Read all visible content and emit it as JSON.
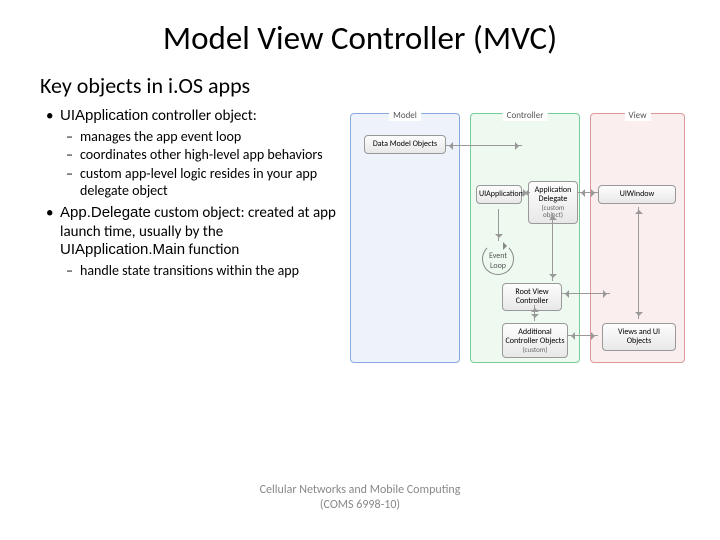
{
  "title": "Model View Controller (MVC)",
  "subtitle": "Key objects in i.OS apps",
  "bullets": [
    {
      "inline": [
        "UIApplication",
        " controller object:"
      ],
      "sub": [
        "manages the app event loop",
        "coordinates other high-level app behaviors",
        "custom app-level logic resides in your app delegate object"
      ]
    },
    {
      "inline": [
        "App.Delegate",
        " custom object: created at app launch time, usually by the ",
        "UIApplication.Main",
        " function"
      ],
      "sub": [
        "handle state transitions within the app"
      ]
    }
  ],
  "diagram": {
    "columns": {
      "model": "Model",
      "controller": "Controller",
      "view": "View"
    },
    "nodes": {
      "data_model": "Data Model Objects",
      "uiapp": "UIApplication",
      "app_delegate_top": "Application Delegate",
      "app_delegate_sub": "(custom object)",
      "uiwindow": "UIWindow",
      "root_vc": "Root View Controller",
      "addl_ctrl_top": "Additional Controller Objects",
      "addl_ctrl_sub": "(custom)",
      "views": "Views and UI Objects",
      "event_loop": "Event Loop"
    }
  },
  "footer": {
    "line1": "Cellular Networks and Mobile Computing",
    "line2": "(COMS 6998-10)"
  }
}
